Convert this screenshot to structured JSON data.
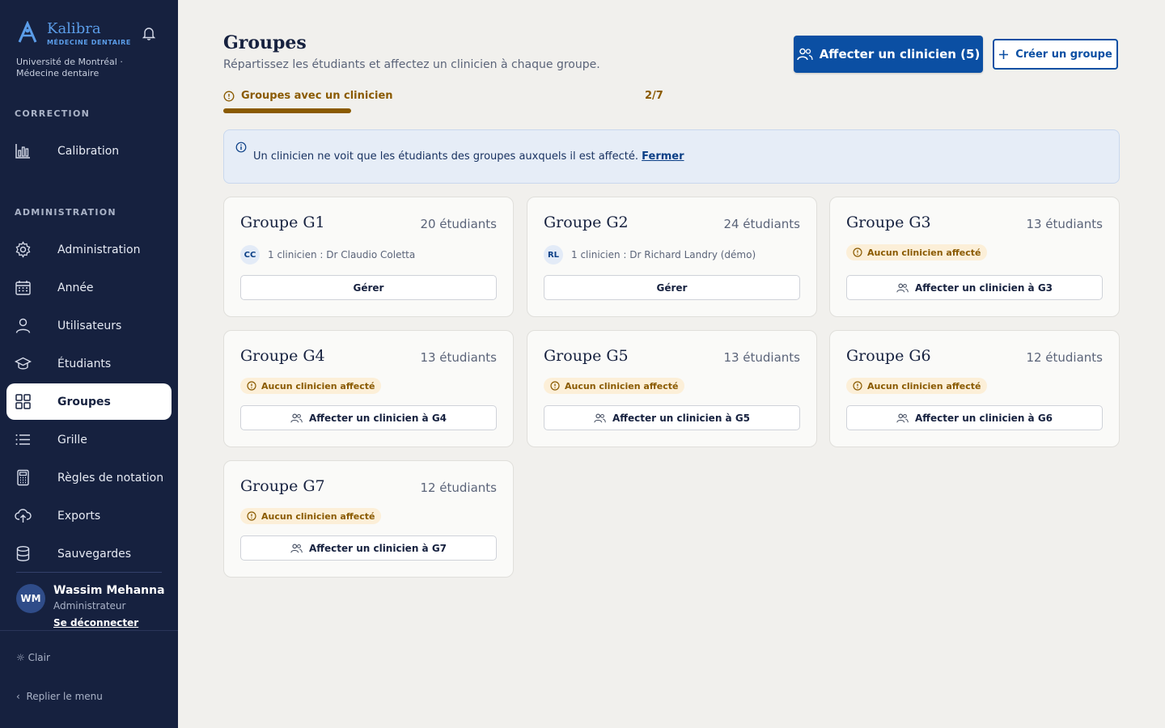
{
  "brand": {
    "name": "Kalibra",
    "sub": "MÉDECINE DENTAIRE",
    "org": "Université de Montréal · Médecine dentaire"
  },
  "sidebar": {
    "sections": {
      "correction": "CORRECTION",
      "administration": "ADMINISTRATION"
    },
    "items": [
      {
        "label": "Calibration",
        "icon": "bar-chart-icon"
      },
      {
        "label": "Administration",
        "icon": "gear-icon"
      },
      {
        "label": "Année",
        "icon": "calendar-icon"
      },
      {
        "label": "Utilisateurs",
        "icon": "user-icon"
      },
      {
        "label": "Étudiants",
        "icon": "graduation-cap-icon"
      },
      {
        "label": "Groupes",
        "icon": "grid-icon",
        "active": true
      },
      {
        "label": "Grille",
        "icon": "list-icon"
      },
      {
        "label": "Règles de notation",
        "icon": "calculator-icon"
      },
      {
        "label": "Exports",
        "icon": "cloud-upload-icon"
      },
      {
        "label": "Sauvegardes",
        "icon": "database-icon"
      }
    ],
    "user": {
      "initials": "WM",
      "name": "Wassim Mehanna",
      "role": "Administrateur",
      "logout": "Se déconnecter"
    },
    "theme": "☼ Clair",
    "collapse": "Replier le menu"
  },
  "header": {
    "title": "Groupes",
    "subtitle": "Répartissez les étudiants et affectez un clinicien à chaque groupe.",
    "primary_button": "Affecter un clinicien (5)",
    "secondary_button": "Créer un groupe"
  },
  "progress": {
    "label": "Groupes avec un clinicien",
    "count": "2/7",
    "fraction": 0.29,
    "color": "#8a5a00"
  },
  "info": {
    "text": "Un clinicien ne voit que les étudiants des groupes auxquels il est affecté.",
    "close": "Fermer"
  },
  "groups": [
    {
      "title": "Groupe G1",
      "count": "20 étudiants",
      "initials": "CC",
      "clinician": "1 clinicien : Dr Claudio Coletta",
      "button": "Gérer"
    },
    {
      "title": "Groupe G2",
      "count": "24 étudiants",
      "initials": "RL",
      "clinician": "1 clinicien : Dr Richard Landry (démo)",
      "button": "Gérer"
    },
    {
      "title": "Groupe G3",
      "count": "13 étudiants",
      "badge": "Aucun clinicien affecté",
      "button": "Affecter un clinicien à G3"
    },
    {
      "title": "Groupe G4",
      "count": "13 étudiants",
      "badge": "Aucun clinicien affecté",
      "button": "Affecter un clinicien à G4"
    },
    {
      "title": "Groupe G5",
      "count": "13 étudiants",
      "badge": "Aucun clinicien affecté",
      "button": "Affecter un clinicien à G5"
    },
    {
      "title": "Groupe G6",
      "count": "12 étudiants",
      "badge": "Aucun clinicien affecté",
      "button": "Affecter un clinicien à G6"
    },
    {
      "title": "Groupe G7",
      "count": "12 étudiants",
      "badge": "Aucun clinicien affecté",
      "button": "Affecter un clinicien à G7"
    }
  ]
}
